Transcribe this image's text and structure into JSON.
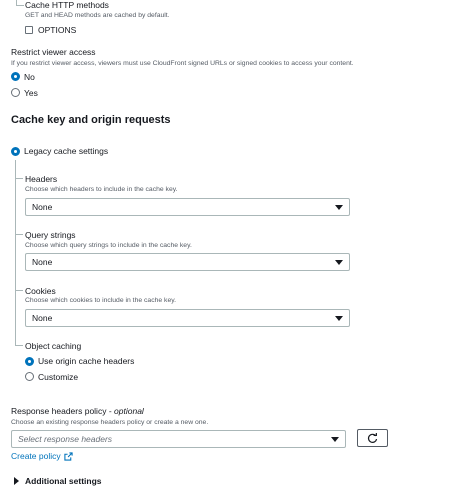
{
  "cache_http": {
    "label": "Cache HTTP methods",
    "description": "GET and HEAD methods are cached by default.",
    "options_label": "OPTIONS"
  },
  "restrict_viewer": {
    "label": "Restrict viewer access",
    "description": "If you restrict viewer access, viewers must use CloudFront signed URLs or signed cookies to access your content.",
    "options": [
      {
        "label": "No",
        "selected": true
      },
      {
        "label": "Yes",
        "selected": false
      }
    ]
  },
  "cache_key": {
    "heading": "Cache key and origin requests",
    "legacy_label": "Legacy cache settings",
    "headers": {
      "label": "Headers",
      "description": "Choose which headers to include in the cache key.",
      "value": "None"
    },
    "query_strings": {
      "label": "Query strings",
      "description": "Choose which query strings to include in the cache key.",
      "value": "None"
    },
    "cookies": {
      "label": "Cookies",
      "description": "Choose which cookies to include in the cache key.",
      "value": "None"
    },
    "object_caching": {
      "label": "Object caching",
      "options": [
        {
          "label": "Use origin cache headers",
          "selected": true
        },
        {
          "label": "Customize",
          "selected": false
        }
      ]
    }
  },
  "response_headers": {
    "label": "Response headers policy",
    "optional": "optional",
    "description": "Choose an existing response headers policy or create a new one.",
    "placeholder": "Select response headers",
    "create_link": "Create policy"
  },
  "additional_settings": {
    "label": "Additional settings"
  },
  "colors": {
    "accent": "#0073bb",
    "border": "#aab7b8",
    "text": "#16191f",
    "muted": "#545b64"
  }
}
